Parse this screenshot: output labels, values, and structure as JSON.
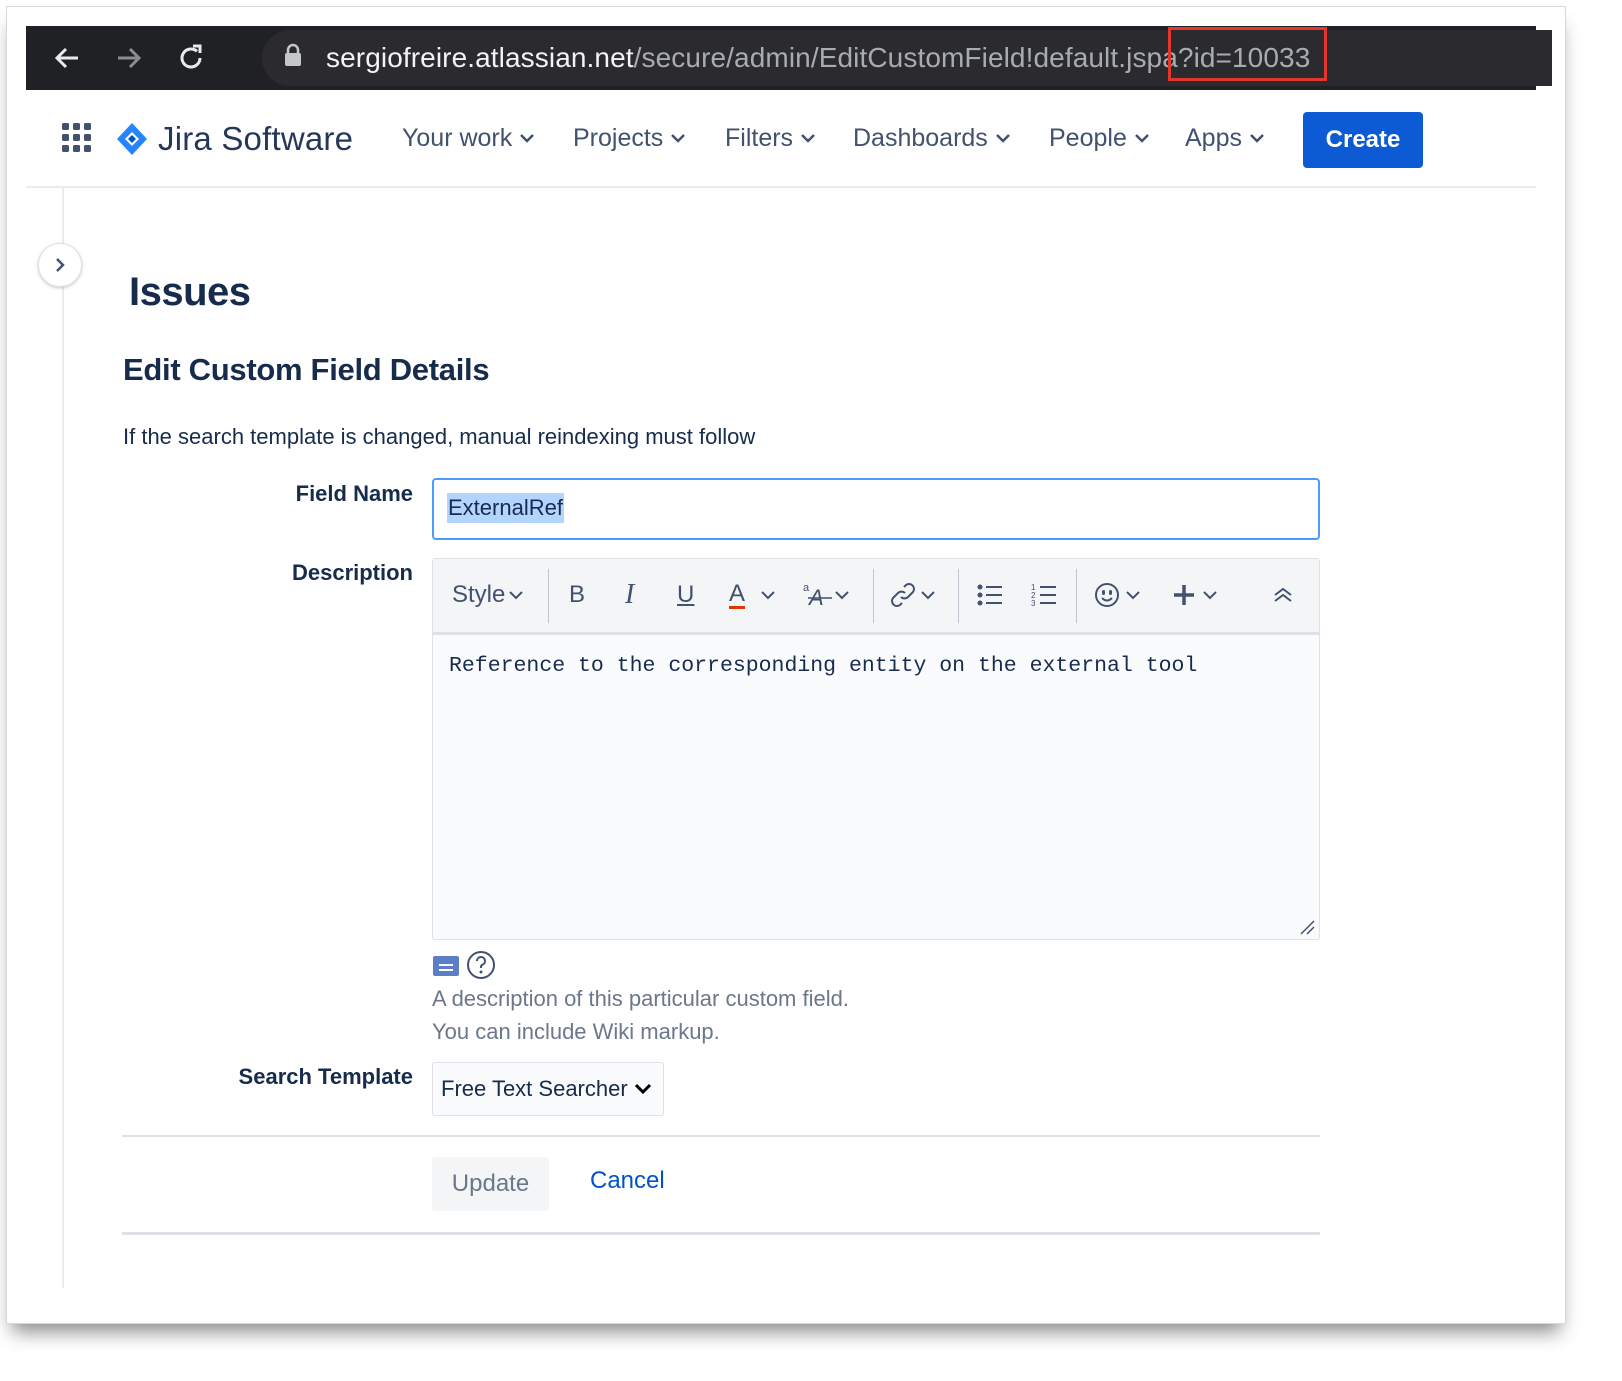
{
  "browser": {
    "url_host": "sergiofreire.atlassian.net",
    "url_path": "/secure/admin/EditCustomField!default.jspa?id=10033",
    "highlight_color": "#e4362b"
  },
  "topnav": {
    "product_name": "Jira Software",
    "items": [
      {
        "label": "Your work"
      },
      {
        "label": "Projects"
      },
      {
        "label": "Filters"
      },
      {
        "label": "Dashboards"
      },
      {
        "label": "People"
      },
      {
        "label": "Apps"
      }
    ],
    "create_label": "Create",
    "accent_color": "#0c5bd4"
  },
  "page": {
    "title": "Issues",
    "section_title": "Edit Custom Field Details",
    "notice": "If the search template is changed, manual reindexing must follow"
  },
  "form": {
    "field_name_label": "Field Name",
    "field_name_value": "ExternalRef",
    "description_label": "Description",
    "toolbar": {
      "style_label": "Style",
      "bold": "B",
      "italic": "I",
      "underline": "U",
      "text_color": "A"
    },
    "description_value": "Reference to the corresponding entity on the external tool",
    "description_help_line1": "A description of this particular custom field.",
    "description_help_line2": "You can include Wiki markup.",
    "search_template_label": "Search Template",
    "search_template_value": "Free Text Searcher",
    "update_label": "Update",
    "cancel_label": "Cancel"
  }
}
